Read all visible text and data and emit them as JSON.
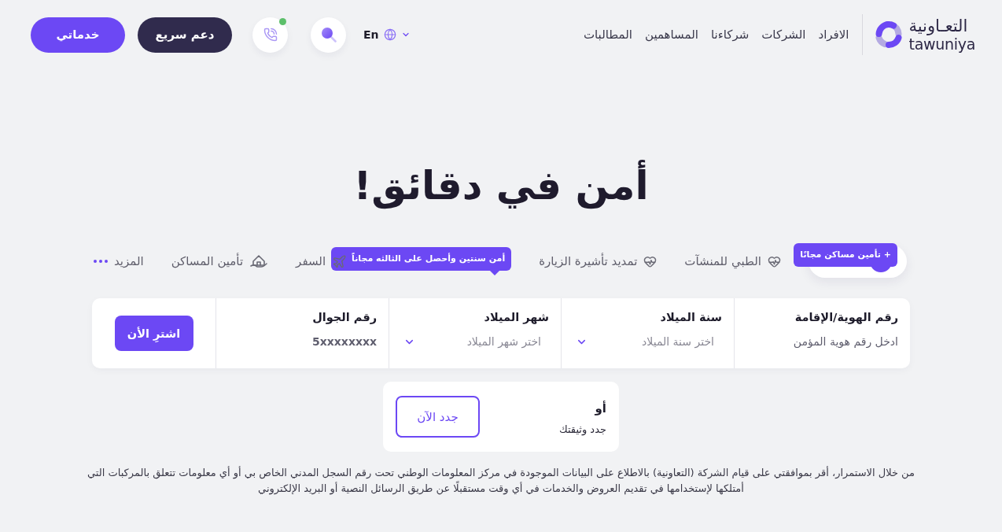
{
  "header": {
    "logo": {
      "arabic": "التعـاونية",
      "latin": "tawuniya"
    },
    "nav": [
      "الافراد",
      "الشركات",
      "شركاءنا",
      "المساهمين",
      "المطالبات"
    ],
    "language": "En",
    "call_online": true,
    "buttons": [
      {
        "kind": "dark",
        "label": "دعم سريع"
      },
      {
        "kind": "primary",
        "label": "خدماتي"
      }
    ]
  },
  "hero": {
    "title": "أمن في دقائق!"
  },
  "tabs": [
    {
      "kind": "featured",
      "selected": true,
      "badge": "+ تأمين مساكن مجانًا"
    },
    {
      "kind": "medical",
      "label": "الطبي للمنشآت",
      "selected": false
    },
    {
      "kind": "visa",
      "label": "تمديد تأشيرة الزيارة",
      "selected": false
    },
    {
      "kind": "travel",
      "label": "السفر",
      "selected": false,
      "badge": "أمن سنتين وأحصل على الثالثه مجاناً"
    },
    {
      "kind": "home",
      "label": "تأمين المساكن",
      "selected": false
    },
    {
      "kind": "more",
      "label": "المزيد",
      "selected": false
    }
  ],
  "quote_form": {
    "fields": [
      {
        "kind": "id",
        "label": "رقم الهوية/الإقامة",
        "placeholder": "ادخل رقم هوية المؤمن"
      },
      {
        "kind": "select",
        "label": "سنة الميلاد",
        "placeholder": "اختر سنة الميلاد"
      },
      {
        "kind": "select",
        "label": "شهر الميلاد",
        "placeholder": "اختر شهر الميلاد"
      },
      {
        "kind": "phone",
        "label": "رقم الجوال",
        "placeholder": "5xxxxxxxx"
      }
    ],
    "submit": "اشترِ الأن"
  },
  "renew": {
    "prefix": "أو",
    "text": "جدد وثيقتك",
    "button": "جدد الآن"
  },
  "consent": "من خلال الاستمرار، أقر بموافقتي على قيام الشركة (التعاونية) بالاطلاع على البيانات الموجودة في مركز المعلومات الوطني تحت رقم السجل المدني الخاص بي أو أي معلومات تتعلق بالمركبات التي أمتلكها لإستخدامها في تقديم العروض والخدمات في أي وقت مستقبلًا عن طريق الرسائل النصية أو البريد الإلكتروني"
}
